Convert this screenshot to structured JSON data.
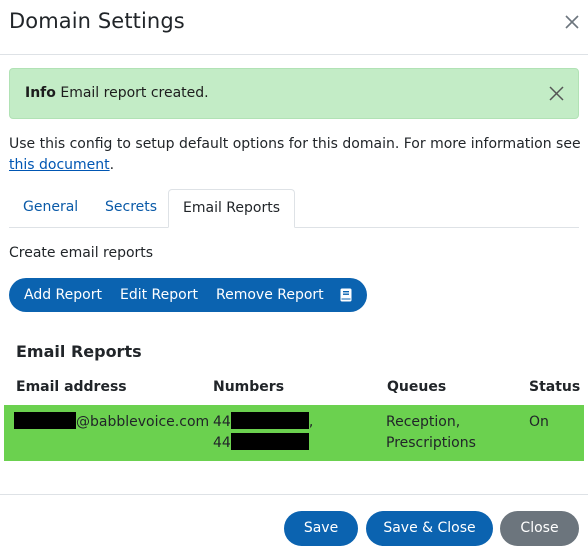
{
  "dialog": {
    "title": "Domain Settings"
  },
  "alert": {
    "strong": "Info",
    "message": "Email report created."
  },
  "description": {
    "text": "Use this config to setup default options for this domain. For more information see ",
    "link_text": "this document",
    "suffix": "."
  },
  "tabs": [
    {
      "label": "General",
      "active": false
    },
    {
      "label": "Secrets",
      "active": false
    },
    {
      "label": "Email Reports",
      "active": true
    }
  ],
  "email_reports": {
    "create_label": "Create email reports",
    "actions": {
      "add": "Add Report",
      "edit": "Edit Report",
      "remove": "Remove Report"
    },
    "section_title": "Email Reports",
    "columns": [
      "Email address",
      "Numbers",
      "Queues",
      "Status"
    ],
    "rows": [
      {
        "email_domain": "@babblevoice.com",
        "numbers_line1_prefix": "44",
        "numbers_line1_suffix": ",",
        "numbers_line2_prefix": "44",
        "queues_line1": "Reception,",
        "queues_line2": "Prescriptions",
        "status": "On",
        "selected_color": "#6bd14f"
      }
    ]
  },
  "footer": {
    "save": "Save",
    "save_close": "Save & Close",
    "close": "Close"
  },
  "colors": {
    "primary": "#0b63b0",
    "alert_bg": "#c3ecc6",
    "secondary": "#6c757d",
    "link": "#0056b3"
  },
  "icons": {
    "dialog_close": "close-icon",
    "alert_close": "close-icon",
    "docs": "book-icon"
  }
}
